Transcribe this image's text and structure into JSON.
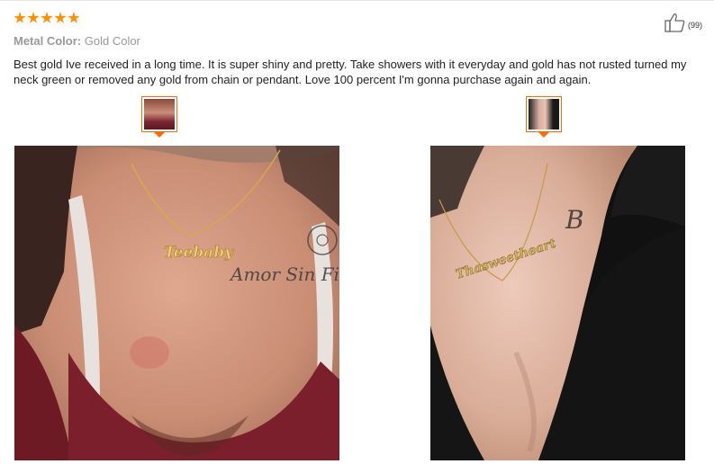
{
  "review": {
    "rating": 5,
    "attribute_label": "Metal Color:",
    "attribute_value": "Gold Color",
    "helpful_count": "(99)",
    "text": "Best gold Ive received in a long time. It is super shiny and pretty. Take showers with it everyday and gold has not rusted turned my neck green or removed any gold from chain or pendant. Love 100 percent I'm gonna purchase again and again."
  },
  "photos": [
    {
      "pendant_text": "Teebaby",
      "tattoo_text": "Amor Sin Fin"
    },
    {
      "pendant_text": "Thasweetheart",
      "tattoo_text": "B"
    }
  ],
  "icons": {
    "star": "star-icon",
    "helpful": "thumbs-up-icon",
    "thumb_arrow": "caret-down-icon"
  },
  "colors": {
    "star": "#ff9000",
    "thumb_border": "#ff6a00",
    "muted_text": "#999999",
    "body_text": "#222222"
  }
}
